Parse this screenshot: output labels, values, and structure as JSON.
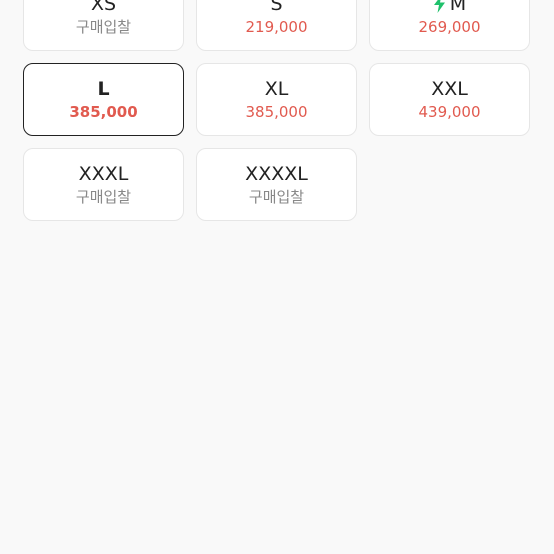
{
  "colors": {
    "price": "#e15a4f",
    "bid_label": "#888888",
    "bolt": "#1fc16b",
    "selected_border": "#222222"
  },
  "options": [
    {
      "size": "XS",
      "sub": "구매입찰",
      "kind": "bid"
    },
    {
      "size": "S",
      "sub": "219,000",
      "kind": "price"
    },
    {
      "size": "M",
      "sub": "269,000",
      "kind": "price",
      "icon": "lightning-bolt-icon"
    },
    {
      "size": "L",
      "sub": "385,000",
      "kind": "price",
      "selected": true
    },
    {
      "size": "XL",
      "sub": "385,000",
      "kind": "price"
    },
    {
      "size": "XXL",
      "sub": "439,000",
      "kind": "price"
    },
    {
      "size": "XXXL",
      "sub": "구매입찰",
      "kind": "bid"
    },
    {
      "size": "XXXXL",
      "sub": "구매입찰",
      "kind": "bid"
    }
  ]
}
